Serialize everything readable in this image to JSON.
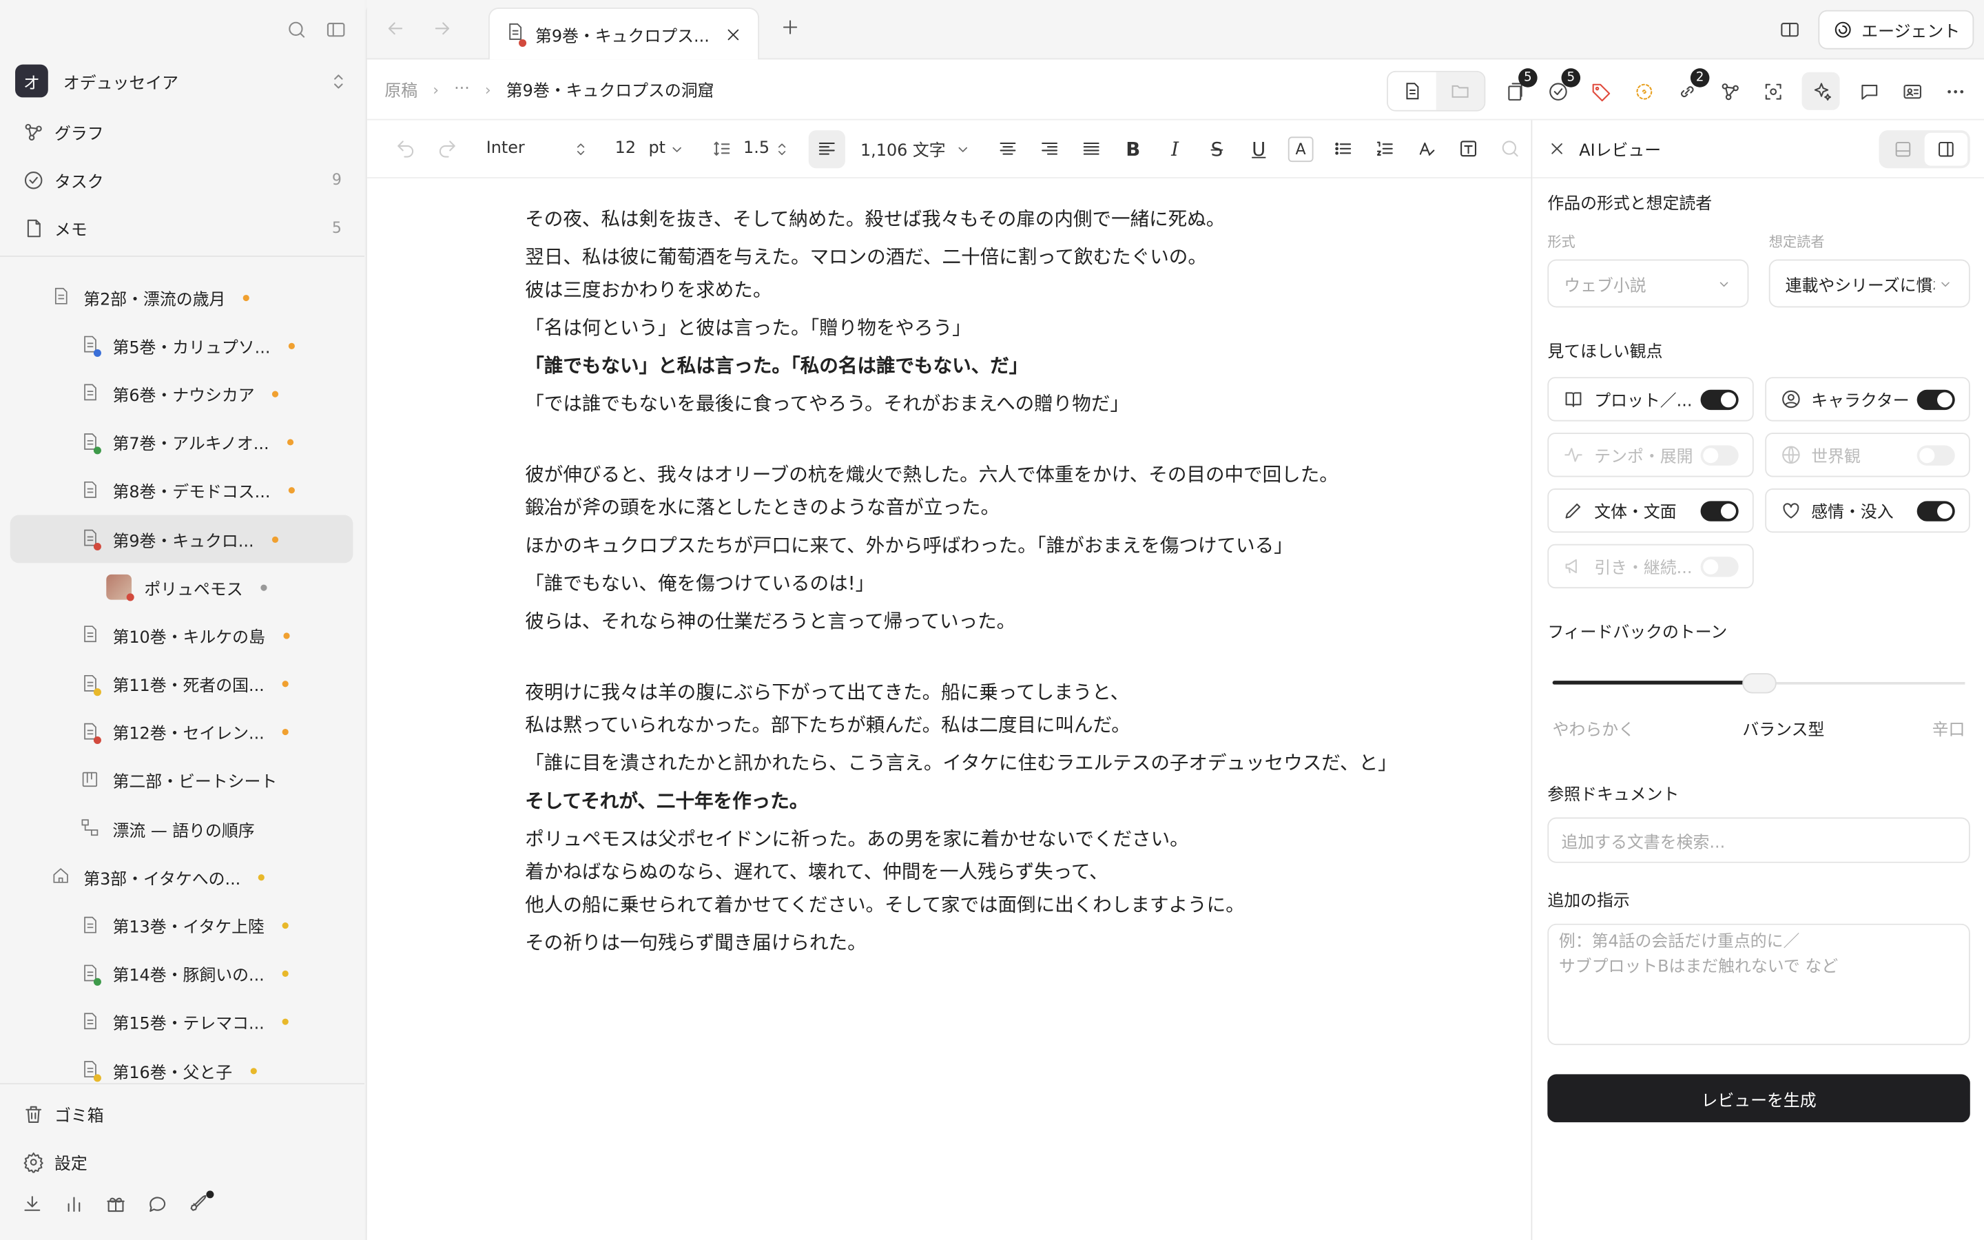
{
  "colors": {
    "accent_dark": "#1f1f22",
    "dot_orange": "#f0a030",
    "dot_gray": "#999999",
    "mark_red": "#d24a3d",
    "mark_blue": "#3a6fd8",
    "mark_green": "#3e9a4a",
    "mark_yellow": "#e8b82a"
  },
  "sidebar": {
    "workspace": {
      "badge": "オ",
      "name": "オデュッセイア"
    },
    "nav": [
      {
        "label": "グラフ",
        "icon": "graph-icon",
        "count": ""
      },
      {
        "label": "タスク",
        "icon": "task-check-icon",
        "count": "9"
      },
      {
        "label": "メモ",
        "icon": "memo-icon",
        "count": "5"
      }
    ],
    "tree": [
      {
        "label": "第2部・漂流の歳月",
        "level": 1,
        "icon": "doc-icon",
        "mark": "",
        "dot": "orange"
      },
      {
        "label": "第5巻・カリュプソ...",
        "level": 2,
        "icon": "doc-icon",
        "mark": "blue",
        "dot": "orange"
      },
      {
        "label": "第6巻・ナウシカア",
        "level": 2,
        "icon": "doc-icon",
        "mark": "",
        "dot": "orange"
      },
      {
        "label": "第7巻・アルキノオ...",
        "level": 2,
        "icon": "doc-icon",
        "mark": "green",
        "dot": "orange"
      },
      {
        "label": "第8巻・デモドコス...",
        "level": 2,
        "icon": "doc-icon",
        "mark": "",
        "dot": "orange"
      },
      {
        "label": "第9巻・キュクロ...",
        "level": 2,
        "icon": "doc-icon",
        "mark": "red",
        "dot": "orange",
        "selected": true
      },
      {
        "label": "ポリュペモス",
        "level": 3,
        "icon": "thumb",
        "mark": "red",
        "dot": "gray"
      },
      {
        "label": "第10巻・キルケの島",
        "level": 2,
        "icon": "doc-icon",
        "mark": "",
        "dot": "orange"
      },
      {
        "label": "第11巻・死者の国...",
        "level": 2,
        "icon": "doc-icon",
        "mark": "yellow",
        "dot": "orange"
      },
      {
        "label": "第12巻・セイレン...",
        "level": 2,
        "icon": "doc-icon",
        "mark": "red",
        "dot": "orange"
      },
      {
        "label": "第二部・ビートシート",
        "level": 2,
        "icon": "board-icon",
        "mark": "",
        "dot": ""
      },
      {
        "label": "漂流 — 語りの順序",
        "level": 2,
        "icon": "flow-icon",
        "mark": "",
        "dot": ""
      },
      {
        "label": "第3部・イタケへの...",
        "level": 1,
        "icon": "home-icon",
        "mark": "",
        "dot": "yellow"
      },
      {
        "label": "第13巻・イタケ上陸",
        "level": 2,
        "icon": "doc-icon",
        "mark": "",
        "dot": "yellow"
      },
      {
        "label": "第14巻・豚飼いの...",
        "level": 2,
        "icon": "doc-icon",
        "mark": "green",
        "dot": "yellow"
      },
      {
        "label": "第15巻・テレマコ...",
        "level": 2,
        "icon": "doc-icon",
        "mark": "",
        "dot": "yellow"
      },
      {
        "label": "第16巻・父と子",
        "level": 2,
        "icon": "doc-icon",
        "mark": "yellow",
        "dot": "yellow"
      }
    ],
    "bottom": [
      {
        "label": "ゴミ箱",
        "icon": "trash-icon"
      },
      {
        "label": "設定",
        "icon": "gear-icon"
      }
    ]
  },
  "tabs": [
    {
      "label": "第9巻・キュクロプス...",
      "active": true
    }
  ],
  "header": {
    "agent_label": "エージェント",
    "breadcrumb": [
      "原稿",
      "···",
      "第9巻・キュクロプスの洞窟"
    ],
    "badges": {
      "pages": "5",
      "tasks": "5",
      "links": "2"
    }
  },
  "toolbar": {
    "font": "Inter",
    "size": "12",
    "unit": "pt",
    "line_height": "1.5",
    "word_count": "1,106 文字"
  },
  "editor": {
    "blocks": [
      [
        {
          "text": "その夜、私は剣を抜き、そして納めた。殺せば我々もその扉の内側で一緒に死ぬ。",
          "bold": false
        },
        {
          "text": "翌日、私は彼に葡萄酒を与えた。マロンの酒だ、二十倍に割って飲むたぐいの。",
          "bold": false,
          "tight": true
        },
        {
          "text": "彼は三度おかわりを求めた。",
          "bold": false
        },
        {
          "text": "「名は何という」と彼は言った。「贈り物をやろう」",
          "bold": false
        },
        {
          "text": "「誰でもない」と私は言った。「私の名は誰でもない、だ」",
          "bold": true
        },
        {
          "text": "「では誰でもないを最後に食ってやろう。それがおまえへの贈り物だ」",
          "bold": false
        }
      ],
      [
        {
          "text": "彼が伸びると、我々はオリーブの杭を熾火で熱した。六人で体重をかけ、その目の中で回した。",
          "bold": false,
          "tight": true
        },
        {
          "text": "鍛冶が斧の頭を水に落としたときのような音が立った。",
          "bold": false
        },
        {
          "text": "ほかのキュクロプスたちが戸口に来て、外から呼ばわった。「誰がおまえを傷つけている」",
          "bold": false
        },
        {
          "text": "「誰でもない、俺を傷つけているのは!」",
          "bold": false
        },
        {
          "text": "彼らは、それなら神の仕業だろうと言って帰っていった。",
          "bold": false
        }
      ],
      [
        {
          "text": "夜明けに我々は羊の腹にぶら下がって出てきた。船に乗ってしまうと、",
          "bold": false,
          "tight": true
        },
        {
          "text": "私は黙っていられなかった。部下たちが頼んだ。私は二度目に叫んだ。",
          "bold": false
        },
        {
          "text": "「誰に目を潰されたかと訊かれたら、こう言え。イタケに住むラエルテスの子オデュッセウスだ、と」",
          "bold": false
        },
        {
          "text": "そしてそれが、二十年を作った。",
          "bold": true
        },
        {
          "text": "ポリュペモスは父ポセイドンに祈った。あの男を家に着かせないでください。",
          "bold": false,
          "tight": true
        },
        {
          "text": "着かねばならぬのなら、遅れて、壊れて、仲間を一人残らず失って、",
          "bold": false,
          "tight": true
        },
        {
          "text": "他人の船に乗せられて着かせてください。そして家では面倒に出くわしますように。",
          "bold": false
        },
        {
          "text": "その祈りは一句残らず聞き届けられた。",
          "bold": false
        }
      ]
    ]
  },
  "panel": {
    "title": "AIレビュー",
    "section_format": "作品の形式と想定読者",
    "format_label": "形式",
    "format_value": "ウェブ小説",
    "audience_label": "想定読者",
    "audience_value": "連載やシリーズに慣れ",
    "section_views": "見てほしい観点",
    "options": [
      {
        "label": "プロット／...",
        "icon": "book-icon",
        "on": true,
        "disabled": false
      },
      {
        "label": "キャラクター",
        "icon": "user-circle-icon",
        "on": true,
        "disabled": false
      },
      {
        "label": "テンポ・展開",
        "icon": "pulse-icon",
        "on": false,
        "disabled": true
      },
      {
        "label": "世界観",
        "icon": "globe-icon",
        "on": false,
        "disabled": true
      },
      {
        "label": "文体・文面",
        "icon": "pen-icon",
        "on": true,
        "disabled": false
      },
      {
        "label": "感情・没入",
        "icon": "heart-icon",
        "on": true,
        "disabled": false
      },
      {
        "label": "引き・継続...",
        "icon": "megaphone-icon",
        "on": false,
        "disabled": true
      }
    ],
    "section_tone": "フィードバックのトーン",
    "tone": {
      "value": 0.5,
      "left": "やわらかく",
      "mid": "バランス型",
      "right": "辛口"
    },
    "section_refs": "参照ドキュメント",
    "refs_placeholder": "追加する文書を検索...",
    "section_extra": "追加の指示",
    "extra_placeholder_1": "例：第4話の会話だけ重点的に／",
    "extra_placeholder_2": "サブプロットBはまだ触れないで など",
    "generate_label": "レビューを生成"
  }
}
